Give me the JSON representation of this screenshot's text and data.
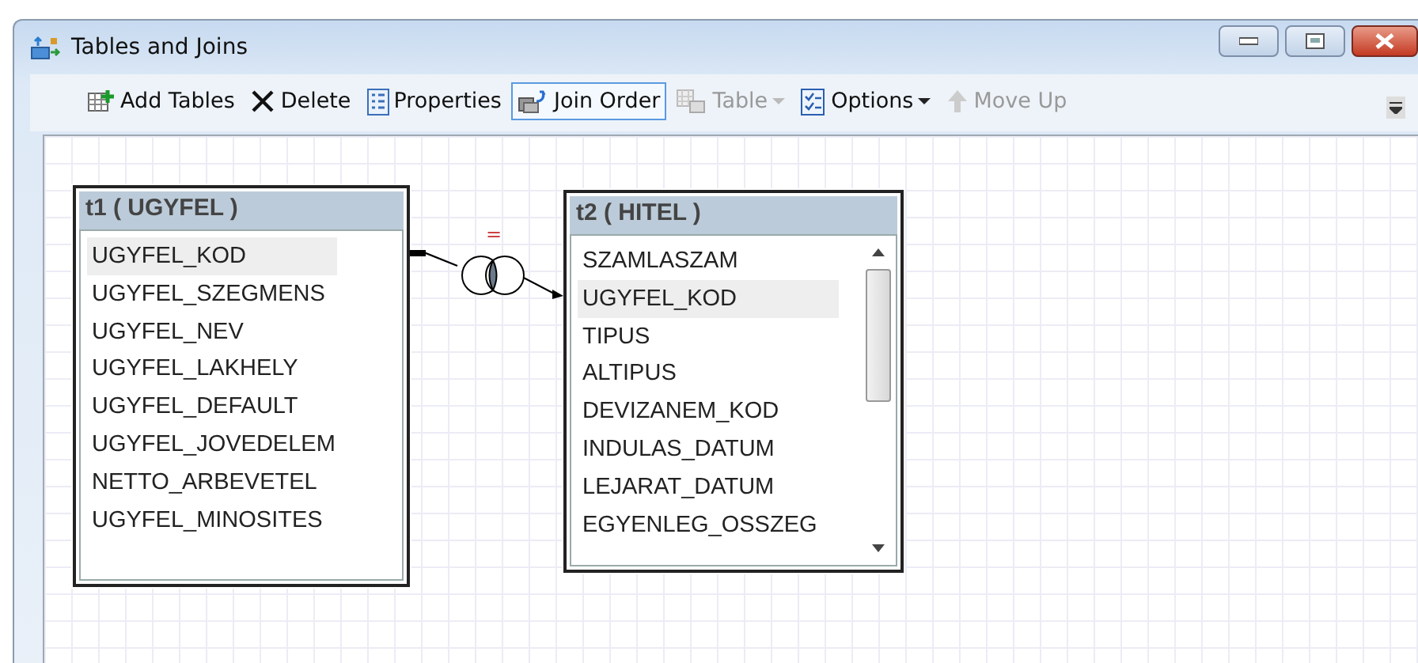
{
  "window": {
    "title": "Tables and Joins"
  },
  "toolbar": [
    {
      "label": "Add Tables",
      "kind": "add-table",
      "selected": false,
      "disabled": false,
      "dropdown": false
    },
    {
      "label": "Delete",
      "kind": "delete",
      "selected": false,
      "disabled": false,
      "dropdown": false
    },
    {
      "label": "Properties",
      "kind": "properties",
      "selected": false,
      "disabled": false,
      "dropdown": false
    },
    {
      "label": "Join Order",
      "kind": "join-order",
      "selected": true,
      "disabled": false,
      "dropdown": false
    },
    {
      "label": "Table",
      "kind": "table",
      "selected": false,
      "disabled": true,
      "dropdown": true
    },
    {
      "label": "Options",
      "kind": "options",
      "selected": false,
      "disabled": false,
      "dropdown": true
    },
    {
      "label": "Move Up",
      "kind": "move-up",
      "selected": false,
      "disabled": true,
      "dropdown": false
    }
  ],
  "tables": [
    {
      "title": "t1 ( UGYFEL )",
      "scrollbar": false,
      "columns": [
        {
          "name": "UGYFEL_KOD",
          "selected": true
        },
        {
          "name": "UGYFEL_SZEGMENS",
          "selected": false
        },
        {
          "name": "UGYFEL_NEV",
          "selected": false
        },
        {
          "name": "UGYFEL_LAKHELY",
          "selected": false
        },
        {
          "name": "UGYFEL_DEFAULT",
          "selected": false
        },
        {
          "name": "UGYFEL_JOVEDELEM",
          "selected": false
        },
        {
          "name": "NETTO_ARBEVETEL",
          "selected": false
        },
        {
          "name": "UGYFEL_MINOSITES",
          "selected": false
        }
      ]
    },
    {
      "title": "t2 ( HITEL )",
      "scrollbar": true,
      "columns": [
        {
          "name": "SZAMLASZAM",
          "selected": false
        },
        {
          "name": "UGYFEL_KOD",
          "selected": true
        },
        {
          "name": "TIPUS",
          "selected": false
        },
        {
          "name": "ALTIPUS",
          "selected": false
        },
        {
          "name": "DEVIZANEM_KOD",
          "selected": false
        },
        {
          "name": "INDULAS_DATUM",
          "selected": false
        },
        {
          "name": "LEJARAT_DATUM",
          "selected": false
        },
        {
          "name": "EGYENLEG_OSSZEG",
          "selected": false
        }
      ]
    }
  ],
  "join": {
    "operator": "="
  }
}
